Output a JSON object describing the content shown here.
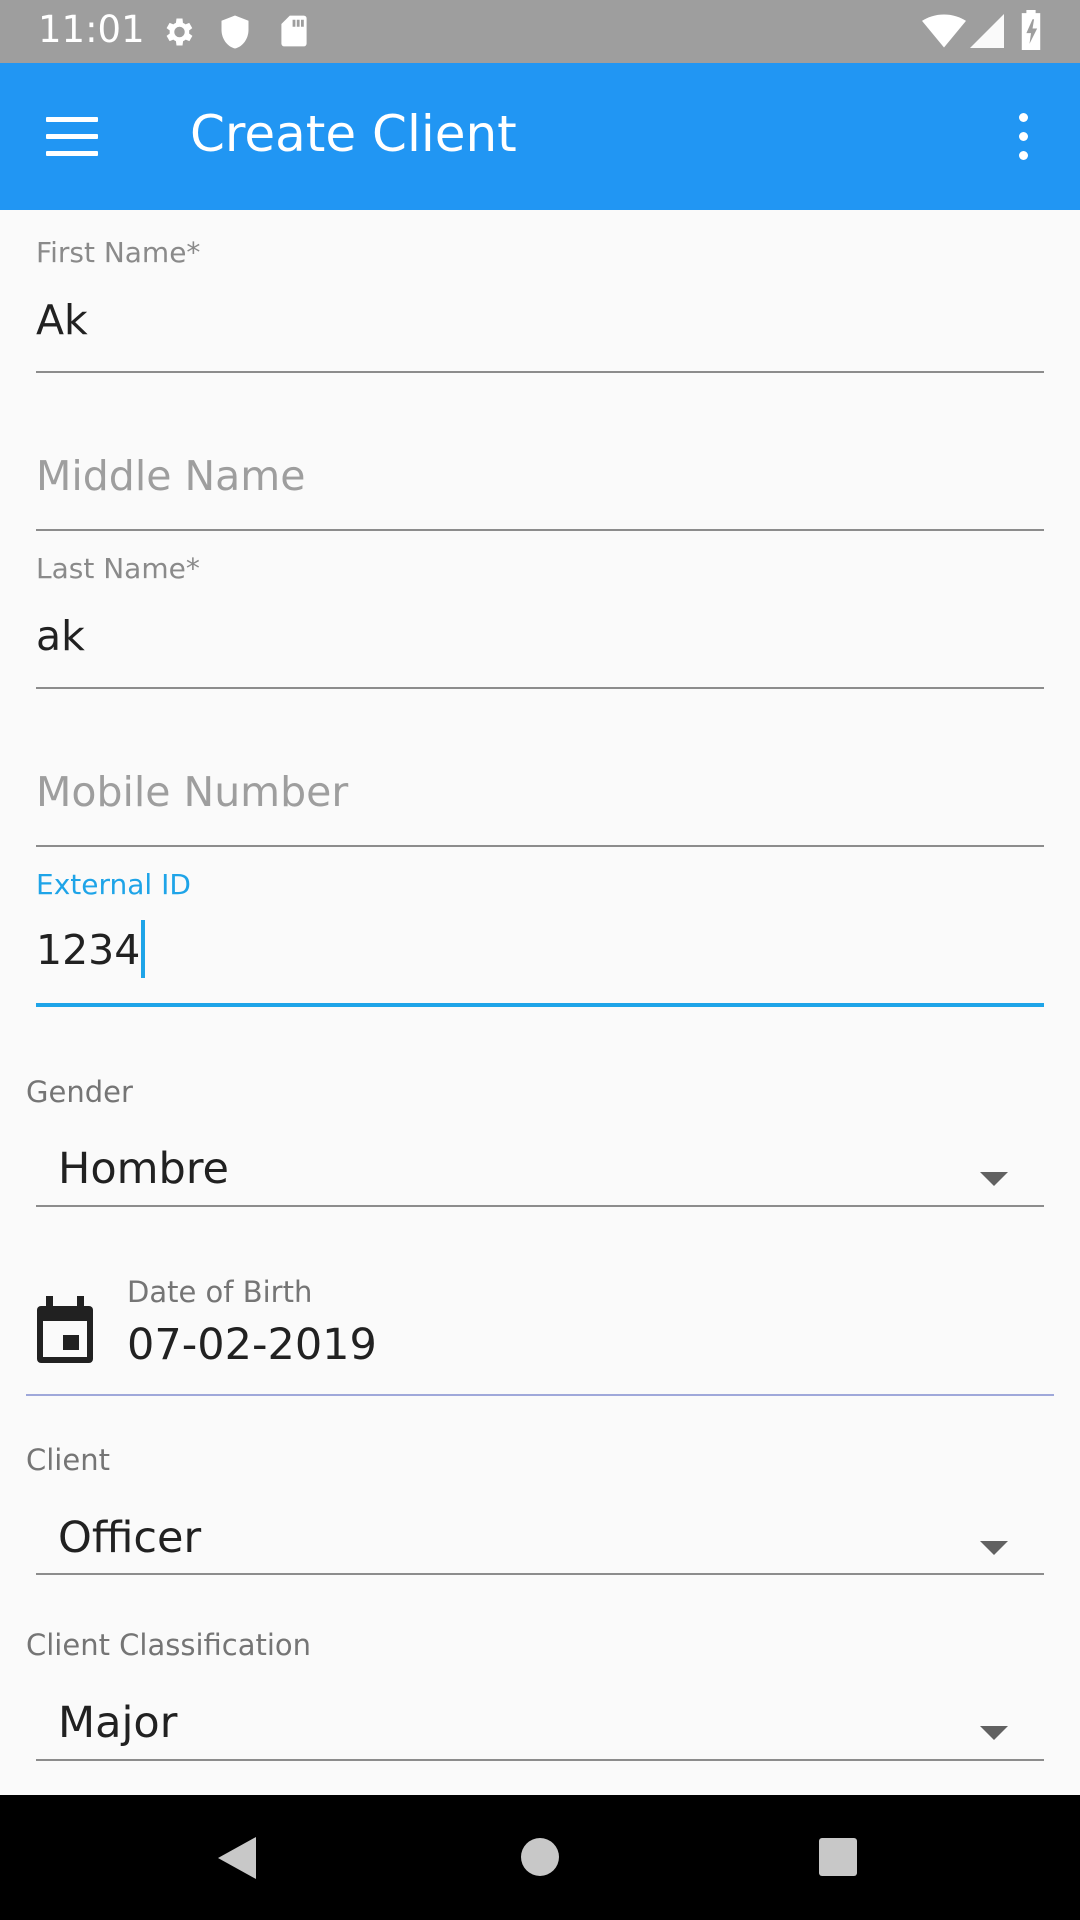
{
  "status_bar": {
    "time": "11:01",
    "icons": [
      "gear-icon",
      "shield-icon",
      "sd-card-icon",
      "wifi-icon",
      "signal-icon",
      "battery-icon"
    ]
  },
  "app_bar": {
    "title": "Create Client",
    "menu_icon": "hamburger-menu-icon",
    "overflow_icon": "more-vert-icon",
    "color": "#2196f3"
  },
  "form": {
    "first_name": {
      "label": "First Name*",
      "value": "Ak"
    },
    "middle_name": {
      "placeholder": "Middle Name"
    },
    "last_name": {
      "label": "Last Name*",
      "value": "ak"
    },
    "mobile_number": {
      "placeholder": "Mobile Number"
    },
    "external_id": {
      "label": "External ID",
      "value": "1234",
      "focused": true
    },
    "gender": {
      "label": "Gender",
      "selected": "Hombre"
    },
    "date_of_birth": {
      "label": "Date of Birth",
      "value": "07-02-2019",
      "icon": "calendar-icon"
    },
    "client": {
      "label": "Client",
      "selected": "Officer"
    },
    "client_classification": {
      "label": "Client Classification",
      "selected": "Major"
    }
  },
  "colors": {
    "accent": "#1ea4e8",
    "status_bar": "#9e9e9e",
    "nav_bar": "#000000"
  },
  "nav_bar": {
    "buttons": [
      "back-icon",
      "home-icon",
      "recents-icon"
    ]
  }
}
